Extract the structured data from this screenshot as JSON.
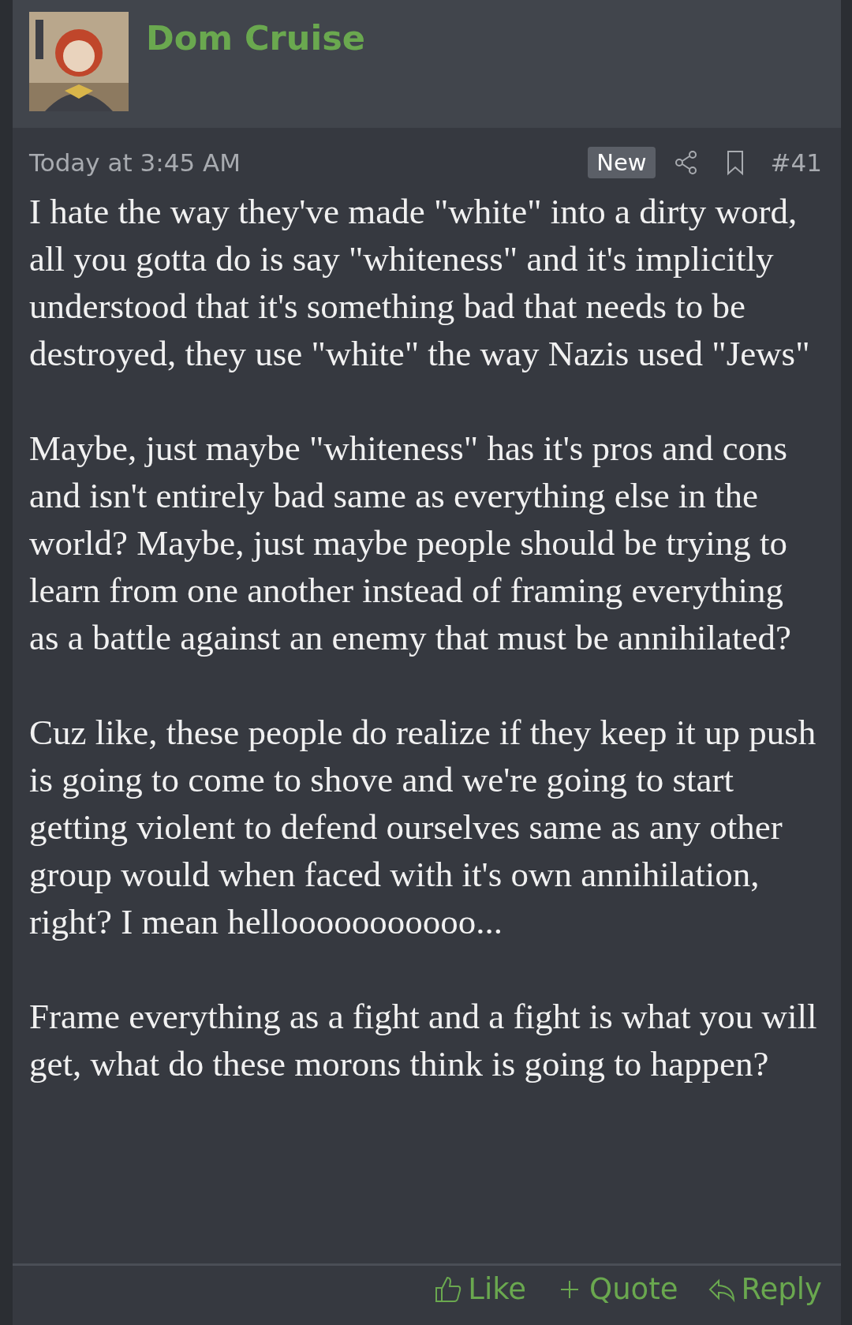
{
  "post": {
    "author": "Dom Cruise",
    "time": "Today at 3:45 AM",
    "badge": "New",
    "number": "#41",
    "paragraphs": [
      "I hate the way they've made \"white\" into a dirty word, all you gotta do is say \"whiteness\" and it's implicitly understood that it's something bad that needs to be destroyed, they use \"white\" the way Nazis used \"Jews\"",
      "Maybe, just maybe \"whiteness\" has it's pros and cons and isn't entirely bad same as everything else in the world? Maybe, just maybe people should be trying to learn from one another instead of framing everything as a battle against an enemy that must be annihilated?",
      "Cuz like, these people do realize if they keep it up push is going to come to shove and we're going to start getting violent to defend ourselves same as any other group would when faced with it's own annihilation, right? I mean hellooooooooooo...",
      "Frame everything as a fight and a fight is what you will get, what do these morons think is going to happen?"
    ],
    "actions": [
      {
        "kind": "like",
        "label": "Like"
      },
      {
        "kind": "quote",
        "label": "Quote"
      },
      {
        "kind": "reply",
        "label": "Reply"
      }
    ]
  }
}
